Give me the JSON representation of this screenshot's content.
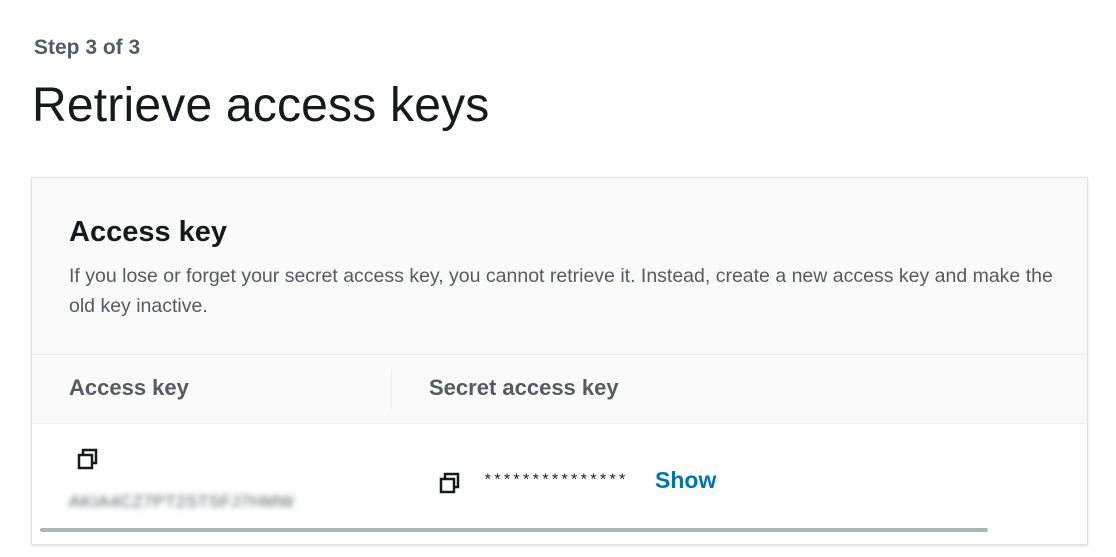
{
  "header": {
    "step": "Step 3 of 3",
    "title": "Retrieve access keys"
  },
  "panel": {
    "title": "Access key",
    "description": "If you lose or forget your secret access key, you cannot retrieve it. Instead, create a new access key and make the old key inactive.",
    "table": {
      "columns": [
        "Access key",
        "Secret access key"
      ],
      "rows": [
        {
          "access_key": "AKIA4CZ7PT2STSFJ7HMW",
          "access_key_copy_icon": "copy-icon",
          "secret_access_key_masked": "***************",
          "secret_copy_icon": "copy-icon",
          "show_label": "Show"
        }
      ]
    }
  },
  "colors": {
    "link": "#0073bb",
    "text_primary": "#16191f",
    "text_secondary": "#545b64",
    "header_bg": "#fafafa"
  }
}
